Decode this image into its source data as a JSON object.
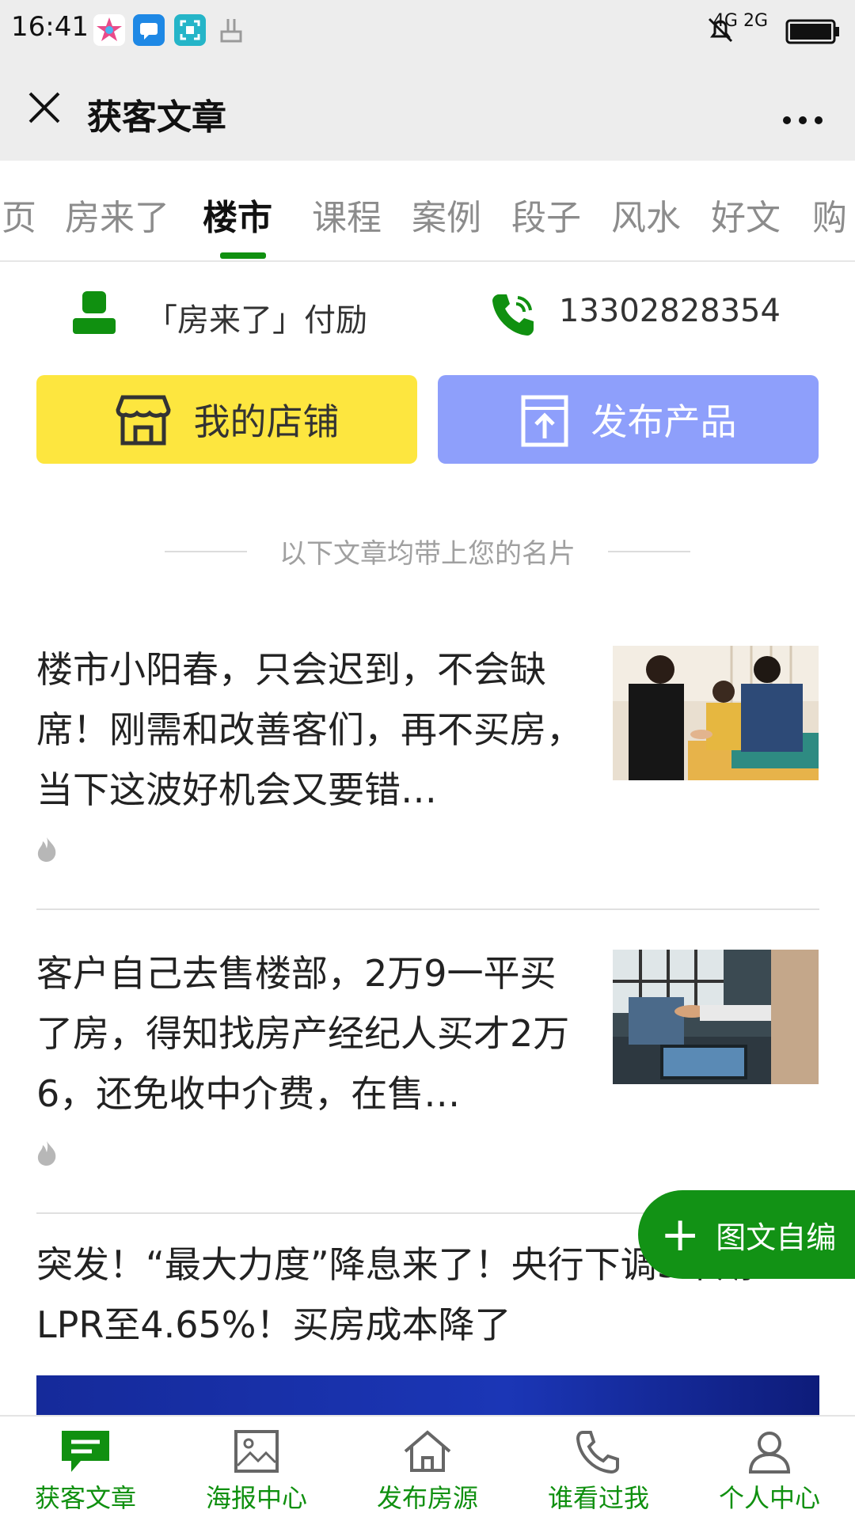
{
  "status_bar": {
    "time": "16:41",
    "network": "4G 2G",
    "icons": [
      "app-icon-colorful",
      "message-icon",
      "scan-icon",
      "hand-icon",
      "mute-bell-icon",
      "battery-icon"
    ]
  },
  "titlebar": {
    "title": "获客文章"
  },
  "tabs": [
    "页",
    "房来了",
    "楼市",
    "课程",
    "案例",
    "段子",
    "风水",
    "好文",
    "购"
  ],
  "active_tab": "楼市",
  "contact": {
    "name": "「房来了」付励",
    "phone": "13302828354"
  },
  "buttons": {
    "shop": "我的店铺",
    "publish": "发布产品"
  },
  "note": "以下文章均带上您的名片",
  "articles": [
    {
      "title": "楼市小阳春，只会迟到，不会缺席！刚需和改善客们，再不买房，当下这波好机会又要错…"
    },
    {
      "title": "客户自己去售楼部，2万9一平买了房，得知找房产经纪人买才2万6，还免收中介费，在售…"
    },
    {
      "title": "突发！“最大力度”降息来了！央行下调5年期LPR至4.65%！买房成本降了"
    }
  ],
  "fab": {
    "label": "图文自编"
  },
  "bottom_nav": [
    {
      "label": "获客文章",
      "icon": "chat-icon"
    },
    {
      "label": "海报中心",
      "icon": "image-icon"
    },
    {
      "label": "发布房源",
      "icon": "home-icon"
    },
    {
      "label": "谁看过我",
      "icon": "phone-icon"
    },
    {
      "label": "个人中心",
      "icon": "user-icon"
    }
  ],
  "colors": {
    "accent_green": "#109010",
    "shop_yellow": "#fde63f",
    "publish_blue": "#8e9ffb",
    "header_gray": "#ededed"
  }
}
